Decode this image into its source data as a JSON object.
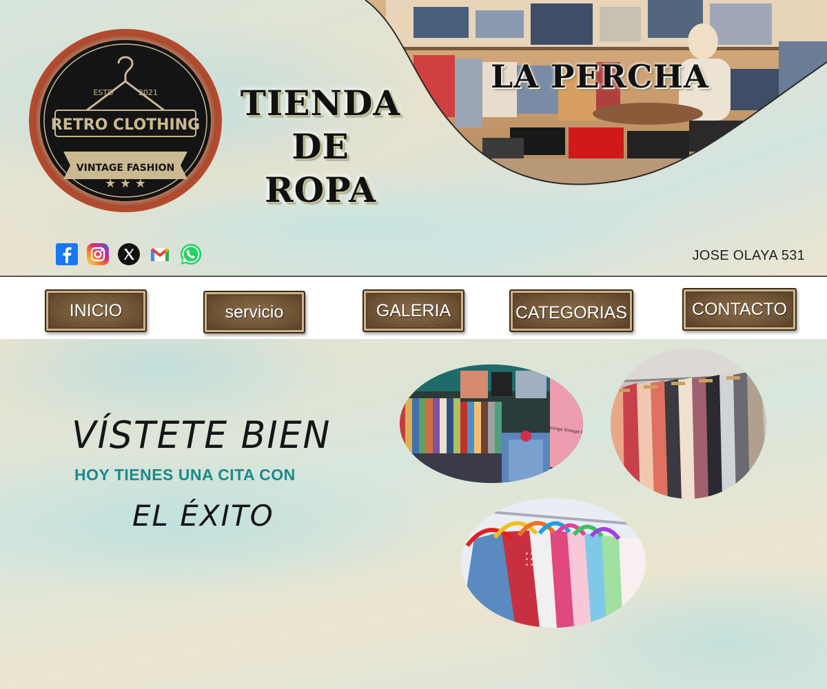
{
  "header": {
    "logo": {
      "estd": "ESTD",
      "year": "2021",
      "name": "RETRO CLOTHING",
      "tagline": "VINTAGE FASHION"
    },
    "title_lines": [
      "TIENDA",
      "DE",
      "ROPA"
    ],
    "brand": "LA PERCHA",
    "social_icons": [
      "facebook-icon",
      "instagram-icon",
      "x-icon",
      "gmail-icon",
      "whatsapp-icon"
    ],
    "address": "JOSE OLAYA 531"
  },
  "nav": {
    "items": [
      {
        "label": "INICIO"
      },
      {
        "label": "servicio"
      },
      {
        "label": "GALERIA"
      },
      {
        "label": "CATEGORIAS"
      },
      {
        "label": "CONTACTO"
      }
    ]
  },
  "main": {
    "slogan_line1": "VÍSTETE BIEN",
    "slogan_line2": "HOY TIENES UNA CITA CON",
    "slogan_line3": "EL ÉXITO",
    "photo_store_sign": "Flamingo Vintage Kilo"
  },
  "colors": {
    "accent_teal": "#1a8a8a",
    "button_brown": "#6c4f30",
    "logo_dark": "#141414",
    "logo_gold": "#cbb992"
  }
}
